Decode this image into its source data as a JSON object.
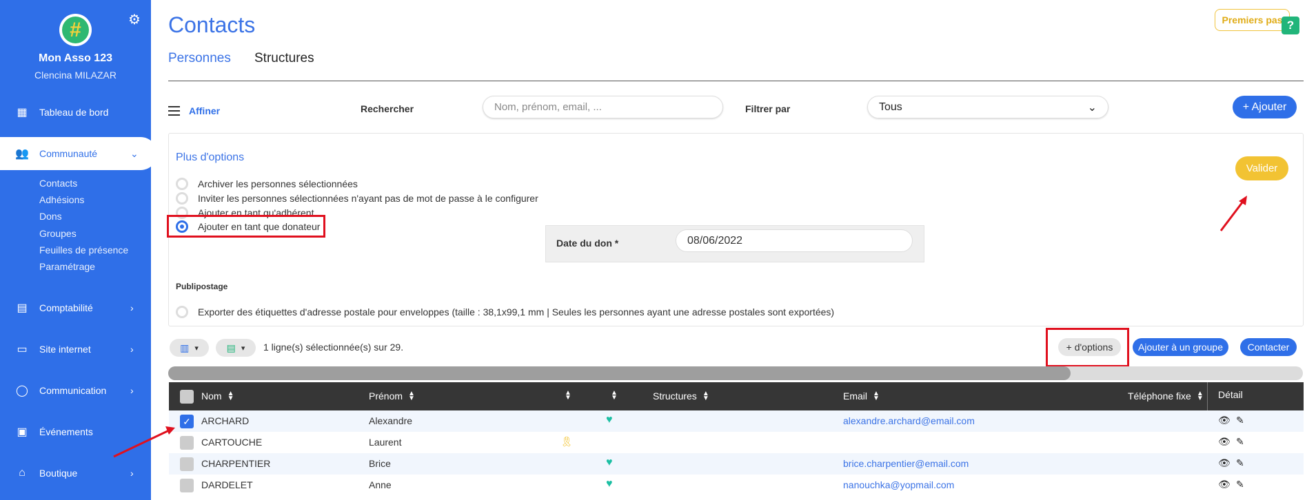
{
  "sidebar": {
    "org_name": "Mon Asso 123",
    "user_name": "Clencina MILAZAR",
    "items": [
      {
        "label": "Tableau de bord"
      },
      {
        "label": "Communauté"
      },
      {
        "label": "Comptabilité"
      },
      {
        "label": "Site internet"
      },
      {
        "label": "Communication"
      },
      {
        "label": "Événements"
      },
      {
        "label": "Boutique"
      }
    ],
    "sub_items": [
      "Contacts",
      "Adhésions",
      "Dons",
      "Groupes",
      "Feuilles de présence",
      "Paramétrage"
    ]
  },
  "header": {
    "title": "Contacts",
    "tabs": [
      "Personnes",
      "Structures"
    ],
    "premiers_pas": "Premiers pas",
    "help": "?"
  },
  "filters": {
    "affiner": "Affiner",
    "rechercher_label": "Rechercher",
    "search_placeholder": "Nom, prénom, email, ...",
    "filtrer_label": "Filtrer par",
    "filter_value": "Tous",
    "add_button": "+ Ajouter"
  },
  "options": {
    "title": "Plus d'options",
    "items": [
      "Archiver les personnes sélectionnées",
      "Inviter les personnes sélectionnées n'ayant pas de mot de passe à le configurer",
      "Ajouter en tant qu'adhérent",
      "Ajouter en tant que donateur"
    ],
    "date_label": "Date du don *",
    "date_value": "08/06/2022",
    "valider": "Valider",
    "publipostage_title": "Publipostage",
    "publipostage_item": "Exporter des étiquettes d'adresse postale pour enveloppes (taille : 38,1x99,1 mm | Seules les personnes ayant une adresse postales sont exportées)"
  },
  "toolbar": {
    "selection_info": "1 ligne(s) sélectionnée(s) sur 29.",
    "more_options": "+ d'options",
    "add_group": "Ajouter à un groupe",
    "contact": "Contacter"
  },
  "table": {
    "headers": {
      "nom": "Nom",
      "prenom": "Prénom",
      "structures": "Structures",
      "email": "Email",
      "telephone": "Téléphone fixe",
      "detail": "Détail"
    },
    "rows": [
      {
        "nom": "ARCHARD",
        "prenom": "Alexandre",
        "email": "alexandre.archard@email.com",
        "checked": true,
        "heart": true,
        "ribbon": false
      },
      {
        "nom": "CARTOUCHE",
        "prenom": "Laurent",
        "email": "",
        "checked": false,
        "heart": false,
        "ribbon": true
      },
      {
        "nom": "CHARPENTIER",
        "prenom": "Brice",
        "email": "brice.charpentier@email.com",
        "checked": false,
        "heart": true,
        "ribbon": false
      },
      {
        "nom": "DARDELET",
        "prenom": "Anne",
        "email": "nanouchka@yopmail.com",
        "checked": false,
        "heart": true,
        "ribbon": false
      }
    ]
  },
  "colors": {
    "sidebar": "#2f6fe8",
    "accent": "#3b73e6",
    "valider": "#f2c333",
    "highlight": "#e0101e",
    "heart": "#1cbfa3"
  }
}
